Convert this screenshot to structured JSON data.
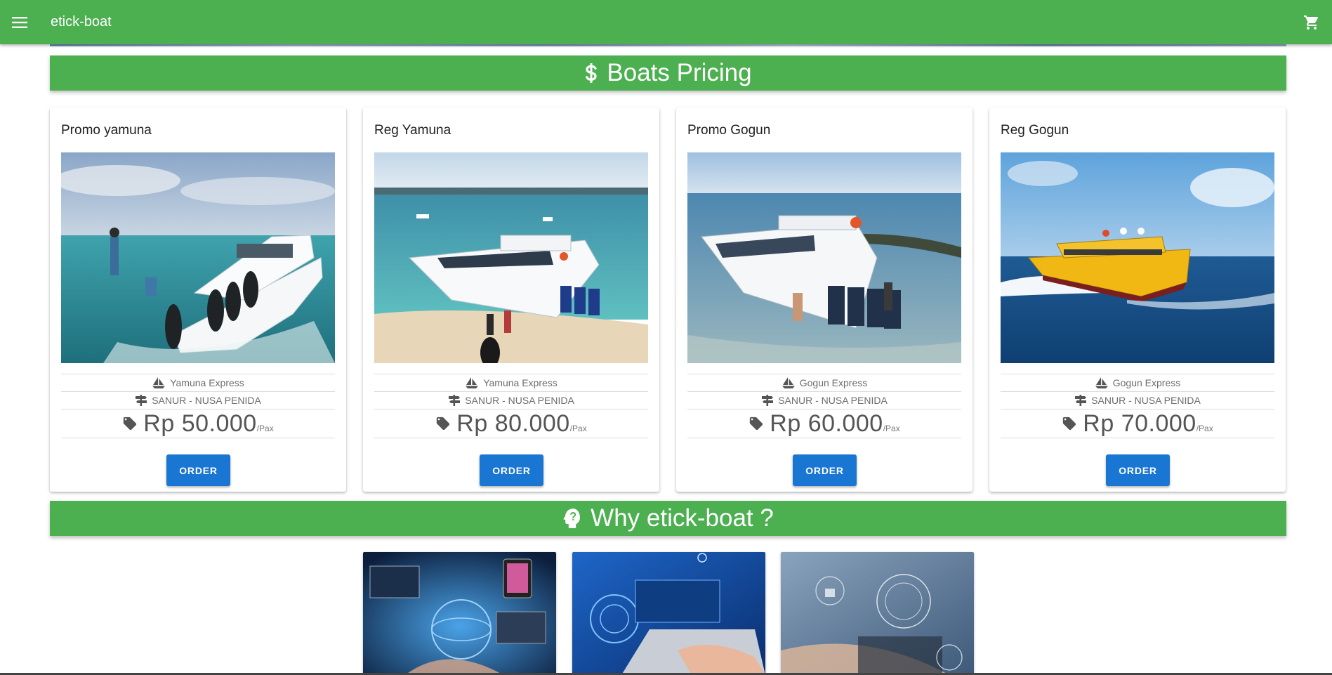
{
  "app": {
    "title": "etick-boat",
    "menu_icon": "menu-icon",
    "cart_icon": "cart-icon"
  },
  "pricing": {
    "title": "Boats Pricing",
    "icon": "dollar-icon"
  },
  "cards": [
    {
      "title": "Promo yamuna",
      "boat": "Yamuna Express",
      "route": "SANUR - NUSA PENIDA",
      "price": "Rp 50.000",
      "unit": "/Pax",
      "order_label": "ORDER"
    },
    {
      "title": "Reg Yamuna",
      "boat": "Yamuna Express",
      "route": "SANUR - NUSA PENIDA",
      "price": "Rp 80.000",
      "unit": "/Pax",
      "order_label": "ORDER"
    },
    {
      "title": "Promo Gogun",
      "boat": "Gogun Express",
      "route": "SANUR - NUSA PENIDA",
      "price": "Rp 60.000",
      "unit": "/Pax",
      "order_label": "ORDER"
    },
    {
      "title": "Reg Gogun",
      "boat": "Gogun Express",
      "route": "SANUR - NUSA PENIDA",
      "price": "Rp 70.000",
      "unit": "/Pax",
      "order_label": "ORDER"
    }
  ],
  "why": {
    "title": "Why etick-boat ?",
    "icon": "head-question-icon"
  },
  "colors": {
    "primary_green": "#4caf50",
    "button_blue": "#1976d2"
  }
}
